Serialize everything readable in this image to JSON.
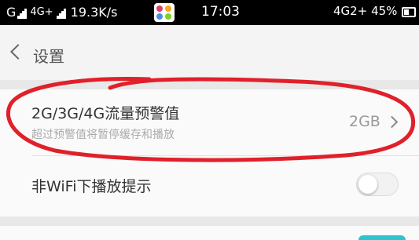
{
  "status_bar": {
    "carrier_left": "G",
    "network_type": "4G+",
    "speed": "19.3K/s",
    "time": "17:03",
    "network_right": "4G2+",
    "battery": "45%"
  },
  "header": {
    "title": "设置"
  },
  "settings": {
    "traffic_warning": {
      "title": "2G/3G/4G流量预警值",
      "subtitle": "超过预警值将暂停缓存和播放",
      "value": "2GB"
    },
    "non_wifi_prompt": {
      "title": "非WiFi下播放提示",
      "enabled": false
    }
  },
  "colors": {
    "annotation": "#e0202a",
    "accent": "#2ec4cf"
  }
}
